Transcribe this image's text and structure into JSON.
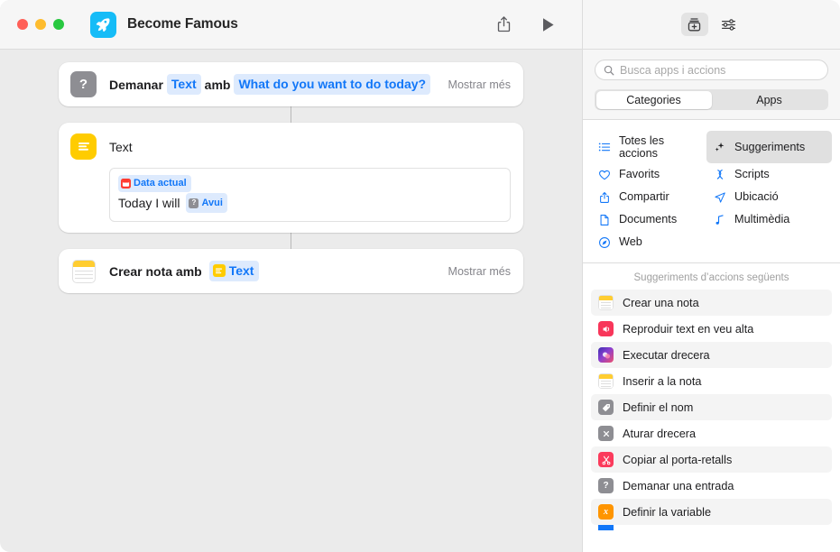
{
  "window": {
    "title": "Become Famous",
    "app_icon": "rocket-icon",
    "traffic_lights": [
      "close",
      "minimize",
      "maximize"
    ],
    "toolbar": [
      {
        "name": "share-icon",
        "label": "Compartir"
      },
      {
        "name": "play-icon",
        "label": "Executar"
      }
    ]
  },
  "workflow": {
    "actions": [
      {
        "icon": "ask-icon",
        "icon_glyph": "?",
        "icon_kind": "q",
        "prefix": "Demanar",
        "param1": "Text",
        "middle": "amb",
        "param2": "What do you want to do today?",
        "show_more": "Mostrar més"
      },
      {
        "icon": "text-icon",
        "icon_kind": "text",
        "title": "Text",
        "field": {
          "token1": {
            "icon": "calendar-icon",
            "label": "Data actual"
          },
          "line2_text": "Today I will",
          "token2": {
            "icon": "ask-icon",
            "label": "Avui"
          }
        }
      },
      {
        "icon": "notes-icon",
        "icon_kind": "notes",
        "prefix": "Crear nota amb",
        "param1": "Text",
        "param1_icon": "text-icon",
        "show_more": "Mostrar més"
      }
    ]
  },
  "sidebar": {
    "toolbar": [
      {
        "name": "action-library-icon",
        "label": "Biblioteca d'accions",
        "selected": true
      },
      {
        "name": "sliders-icon",
        "label": "Detalls de la drecera",
        "selected": false
      }
    ],
    "search": {
      "placeholder": "Busca apps i accions",
      "value": "",
      "icon": "search-icon"
    },
    "tabs": [
      {
        "label": "Categories",
        "active": true
      },
      {
        "label": "Apps",
        "active": false
      }
    ],
    "categories": [
      {
        "label": "Totes les accions",
        "icon": "list-icon",
        "selected": false,
        "two_line": true
      },
      {
        "label": "Suggeriments",
        "icon": "sparkles-icon",
        "selected": true,
        "two_line": false
      },
      {
        "label": "Favorits",
        "icon": "heart-icon",
        "selected": false,
        "two_line": false
      },
      {
        "label": "Scripts",
        "icon": "script-icon",
        "selected": false,
        "two_line": false
      },
      {
        "label": "Compartir",
        "icon": "share-icon",
        "selected": false,
        "two_line": false
      },
      {
        "label": "Ubicació",
        "icon": "location-icon",
        "selected": false,
        "two_line": false
      },
      {
        "label": "Documents",
        "icon": "document-icon",
        "selected": false,
        "two_line": false
      },
      {
        "label": "Multimèdia",
        "icon": "music-note-icon",
        "selected": false,
        "two_line": false
      },
      {
        "label": "Web",
        "icon": "compass-icon",
        "selected": false,
        "two_line": false
      }
    ],
    "suggestions_header": "Suggeriments d’accions següents",
    "suggestions": [
      {
        "label": "Crear una nota",
        "icon": "notes-icon",
        "alt": true
      },
      {
        "label": "Reproduir text en veu alta",
        "icon": "speaker-icon",
        "alt": false
      },
      {
        "label": "Executar drecera",
        "icon": "shortcuts-icon",
        "alt": true
      },
      {
        "label": "Inserir a la nota",
        "icon": "notes-icon",
        "alt": false
      },
      {
        "label": "Definir el nom",
        "icon": "tag-icon",
        "alt": true
      },
      {
        "label": "Aturar drecera",
        "icon": "x-icon",
        "alt": false
      },
      {
        "label": "Copiar al porta-retalls",
        "icon": "scissors-icon",
        "alt": true
      },
      {
        "label": "Demanar una entrada",
        "icon": "question-mark-icon",
        "alt": false
      },
      {
        "label": "Definir la variable",
        "icon": "variable-icon",
        "alt": true
      }
    ]
  },
  "colors": {
    "accent_blue": "#1277f8",
    "token_bg": "#ddeafd",
    "canvas_bg": "#ebebeb",
    "app_icon_bg": "#16bcf7",
    "yellow": "#ffcc00",
    "red": "#ff3b30",
    "gray": "#8e8e93",
    "orange": "#ff9500"
  }
}
